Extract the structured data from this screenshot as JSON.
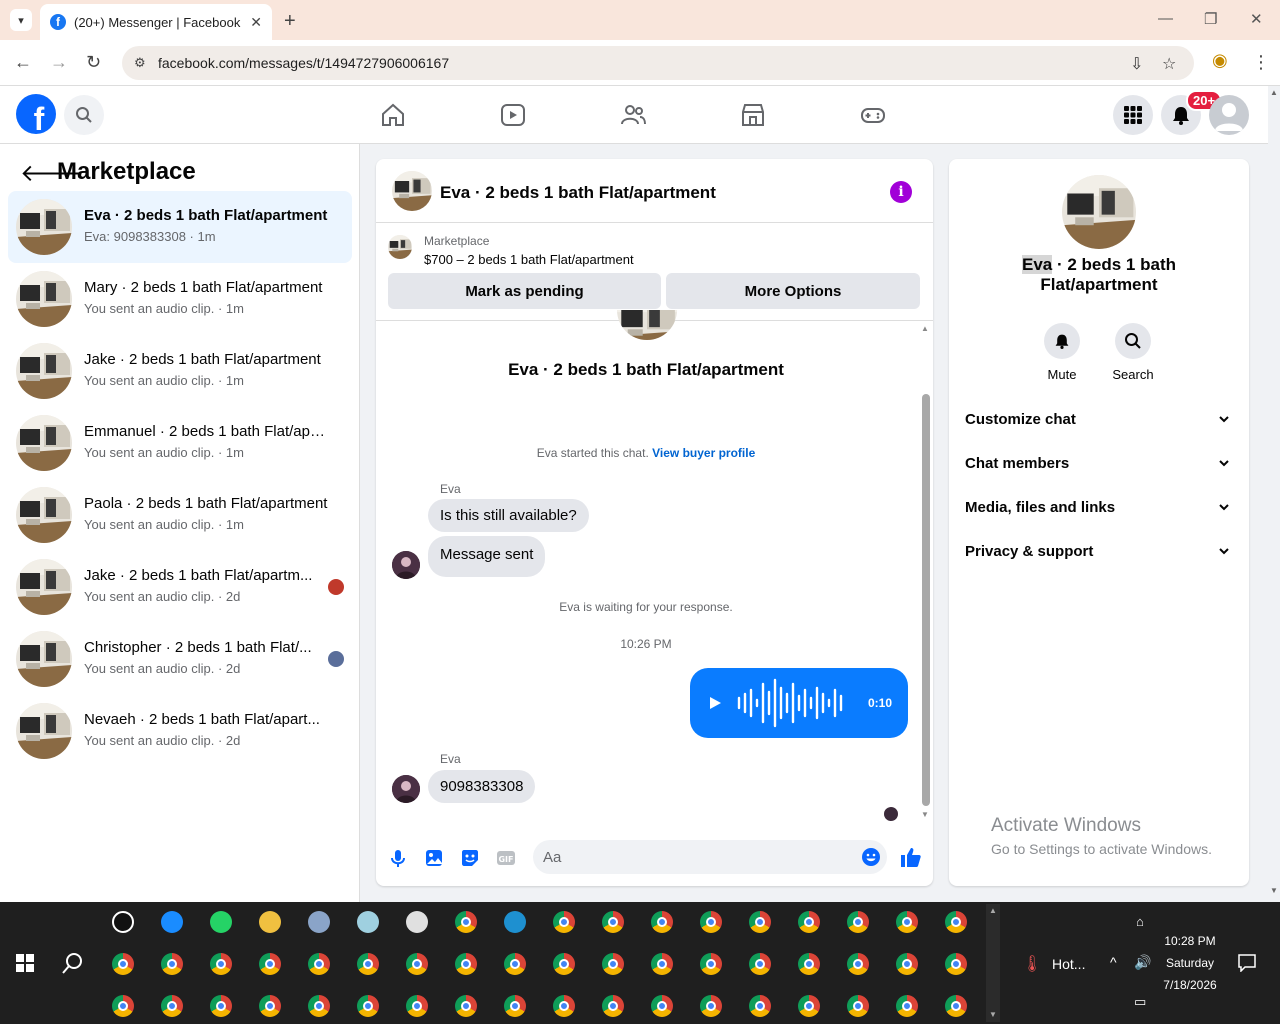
{
  "browser": {
    "tab_title": "(20+) Messenger | Facebook",
    "url": "facebook.com/messages/t/1494727906006167"
  },
  "header": {
    "notification_badge": "20+"
  },
  "left_panel": {
    "title": "Marketplace",
    "conversations": [
      {
        "name": "Eva · 2 beds 1 bath Flat/apartment",
        "sub": "Eva: 9098383308 · 1m"
      },
      {
        "name": "Mary · 2 beds 1 bath Flat/apartment",
        "sub": "You sent an audio clip. · 1m"
      },
      {
        "name": "Jake · 2 beds 1 bath Flat/apartment",
        "sub": "You sent an audio clip. · 1m"
      },
      {
        "name": "Emmanuel · 2 beds 1 bath Flat/apa...",
        "sub": "You sent an audio clip. · 1m"
      },
      {
        "name": "Paola · 2 beds 1 bath Flat/apartment",
        "sub": "You sent an audio clip. · 1m"
      },
      {
        "name": "Jake · 2 beds 1 bath Flat/apartm...",
        "sub": "You sent an audio clip. · 2d"
      },
      {
        "name": "Christopher · 2 beds 1 bath Flat/...",
        "sub": "You sent an audio clip. · 2d"
      },
      {
        "name": "Nevaeh · 2 beds 1 bath Flat/apart...",
        "sub": "You sent an audio clip. · 2d"
      }
    ]
  },
  "chat": {
    "title": "Eva · 2 beds 1 bath Flat/apartment",
    "marketplace_label": "Marketplace",
    "listing": "$700 – 2 beds 1 bath Flat/apartment",
    "mark_pending": "Mark as pending",
    "more_options": "More Options",
    "intro_name": "Eva · 2 beds 1 bath Flat/apartment",
    "started_text": "Eva started this chat.",
    "view_profile": "View buyer profile",
    "sender1": "Eva",
    "msg1": "Is this still available?",
    "msg2": "Message sent",
    "waiting": "Eva is waiting for your response.",
    "time": "10:26 PM",
    "audio_duration": "0:10",
    "sender2": "Eva",
    "msg3": "9098383308",
    "input_placeholder": "Aa"
  },
  "right_panel": {
    "name_highlight": "Eva",
    "name_rest": " · 2 beds 1 bath Flat/apartment",
    "mute": "Mute",
    "search": "Search",
    "rows": [
      "Customize chat",
      "Chat members",
      "Media, files and links",
      "Privacy & support"
    ],
    "activate_title": "Activate Windows",
    "activate_sub": "Go to Settings to activate Windows."
  },
  "taskbar": {
    "weather": "Hot...",
    "time": "10:28 PM",
    "day": "Saturday",
    "date": "7/18/2026"
  }
}
